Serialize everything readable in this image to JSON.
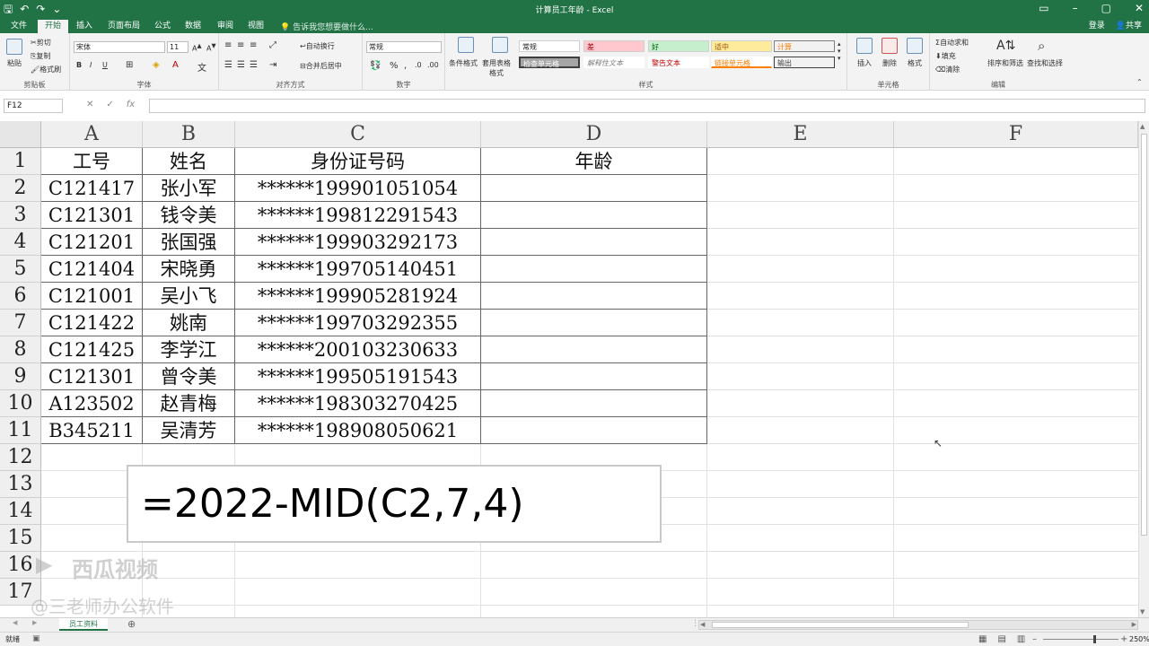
{
  "window": {
    "title": "计算员工年龄 - Excel",
    "account": "登录",
    "share": "共享"
  },
  "qat_icons": [
    "save-icon",
    "undo-icon",
    "redo-icon",
    "customize-icon"
  ],
  "ribbon_tabs": [
    "文件",
    "开始",
    "插入",
    "页面布局",
    "公式",
    "数据",
    "审阅",
    "视图"
  ],
  "active_tab": "开始",
  "tell_me": "告诉我您想要做什么...",
  "ribbon": {
    "clipboard": {
      "paste": "粘贴",
      "cut": "剪切",
      "copy": "复制",
      "painter": "格式刷",
      "label": "剪贴板"
    },
    "font": {
      "name": "宋体",
      "size": "11",
      "bold": "B",
      "italic": "I",
      "underline": "U",
      "label": "字体"
    },
    "align": {
      "wrap": "自动换行",
      "merge": "合并后居中",
      "label": "对齐方式"
    },
    "number": {
      "format": "常规",
      "percent": "%",
      "label": "数字"
    },
    "styles": {
      "cond": "条件格式",
      "table": "套用表格格式",
      "cells": [
        "常规",
        "差",
        "好",
        "适中",
        "计算",
        "检查单元格",
        "解释性文本",
        "警告文本",
        "链接单元格",
        "输出"
      ],
      "label": "样式"
    },
    "cells": {
      "insert": "插入",
      "delete": "删除",
      "format": "格式",
      "label": "单元格"
    },
    "edit": {
      "autosum": "自动求和",
      "fill": "填充",
      "clear": "清除",
      "sort": "排序和筛选",
      "find": "查找和选择",
      "label": "编辑"
    }
  },
  "formula_bar": {
    "name_box": "F12",
    "fx": "fx",
    "value": ""
  },
  "columns": [
    "A",
    "B",
    "C",
    "D",
    "E",
    "F"
  ],
  "row_numbers": [
    "1",
    "2",
    "3",
    "4",
    "5",
    "6",
    "7",
    "8",
    "9",
    "10",
    "11",
    "12",
    "13",
    "14",
    "15",
    "16",
    "17"
  ],
  "table": {
    "header": [
      "工号",
      "姓名",
      "身份证号码",
      "年龄"
    ],
    "rows": [
      [
        "C121417",
        "张小军",
        "******199901051054",
        ""
      ],
      [
        "C121301",
        "钱令美",
        "******199812291543",
        ""
      ],
      [
        "C121201",
        "张国强",
        "******199903292173",
        ""
      ],
      [
        "C121404",
        "宋晓勇",
        "******199705140451",
        ""
      ],
      [
        "C121001",
        "吴小飞",
        "******199905281924",
        ""
      ],
      [
        "C121422",
        "姚南",
        "******199703292355",
        ""
      ],
      [
        "C121425",
        "李学江",
        "******200103230633",
        ""
      ],
      [
        "C121301",
        "曾令美",
        "******199505191543",
        ""
      ],
      [
        "A123502",
        "赵青梅",
        "******198303270425",
        ""
      ],
      [
        "B345211",
        "吴清芳",
        "******198908050621",
        ""
      ]
    ]
  },
  "formula_overlay": "=2022-MID(C2,7,4)",
  "watermarks": [
    "西瓜视频",
    "@三老师办公软件"
  ],
  "sheet_tab": "员工资料",
  "status": {
    "ready": "就绪",
    "zoom": "250%"
  },
  "colors": {
    "brand": "#217346"
  }
}
